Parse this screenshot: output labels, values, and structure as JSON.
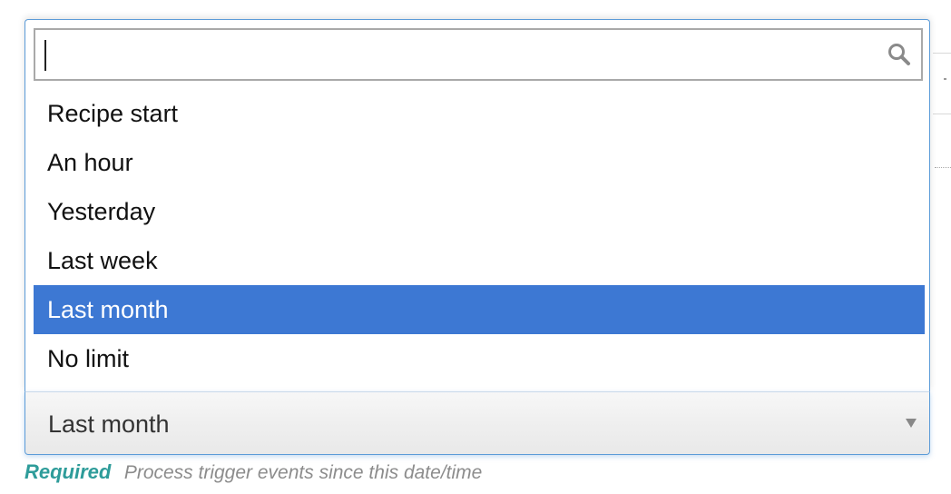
{
  "dropdown": {
    "search": {
      "value": "",
      "placeholder": "",
      "icon": "search-icon"
    },
    "options": [
      {
        "label": "Recipe start",
        "highlighted": false
      },
      {
        "label": "An hour",
        "highlighted": false
      },
      {
        "label": "Yesterday",
        "highlighted": false
      },
      {
        "label": "Last week",
        "highlighted": false
      },
      {
        "label": "Last month",
        "highlighted": true
      },
      {
        "label": "No limit",
        "highlighted": false
      }
    ]
  },
  "select": {
    "value": "Last month",
    "arrow_icon": "triangle-down-icon"
  },
  "hint": {
    "required": "Required",
    "text": "Process trigger events since this date/time"
  },
  "colors": {
    "highlight": "#3d78d3",
    "border_focus": "#5b9bd8",
    "required": "#2e9c9a",
    "hint": "#8c8c8c"
  }
}
